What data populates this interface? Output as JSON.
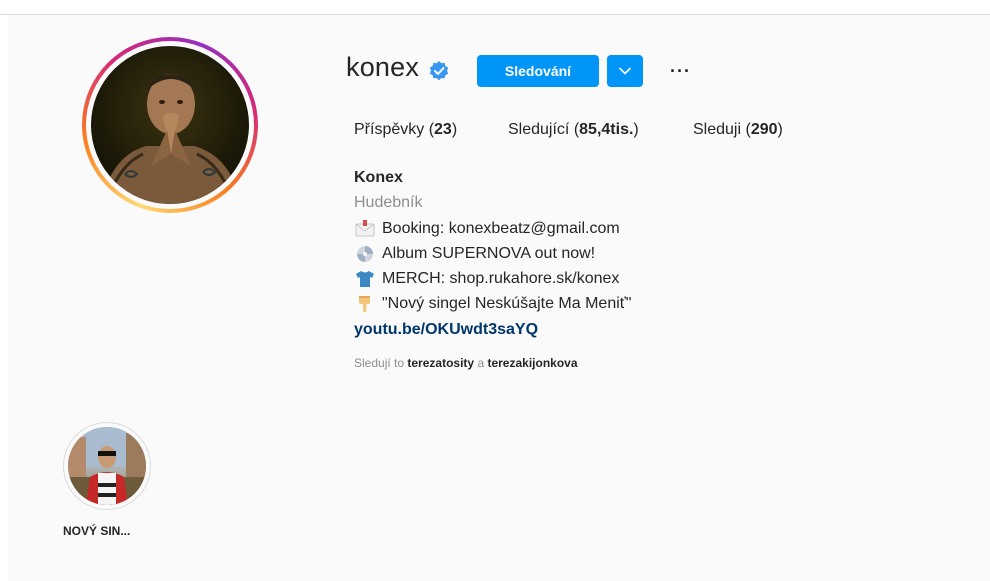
{
  "profile": {
    "username": "konex",
    "verified": true,
    "follow_button_label": "Sledování",
    "more_label": "···"
  },
  "stats": {
    "posts_label": "Příspěvky",
    "posts_count": "23",
    "followers_label": "Sledující",
    "followers_count": "85,4tis.",
    "following_label": "Sleduji",
    "following_count": "290"
  },
  "bio": {
    "name": "Konex",
    "category": "Hudebník",
    "lines": [
      {
        "icon": "envelope-icon",
        "text": "Booking: konexbeatz@gmail.com"
      },
      {
        "icon": "disc-icon",
        "text": "Album SUPERNOVA out now!"
      },
      {
        "icon": "tshirt-icon",
        "text": "MERCH: shop.rukahore.sk/konex"
      },
      {
        "icon": "pointing-down-icon",
        "text": "\"Nový singel Neskúšajte Ma Meniť\""
      }
    ],
    "link": "youtu.be/OKUwdt3saYQ",
    "followed_by_prefix": "Sledují to",
    "followed_by_user1": "terezatosity",
    "followed_by_joiner": "a",
    "followed_by_user2": "terezakijonkova"
  },
  "highlights": [
    {
      "label": "NOVÝ SIN..."
    }
  ],
  "colors": {
    "accent": "#0095f6",
    "link": "#00376b",
    "muted": "#8e8e8e",
    "background": "#fafafa"
  }
}
